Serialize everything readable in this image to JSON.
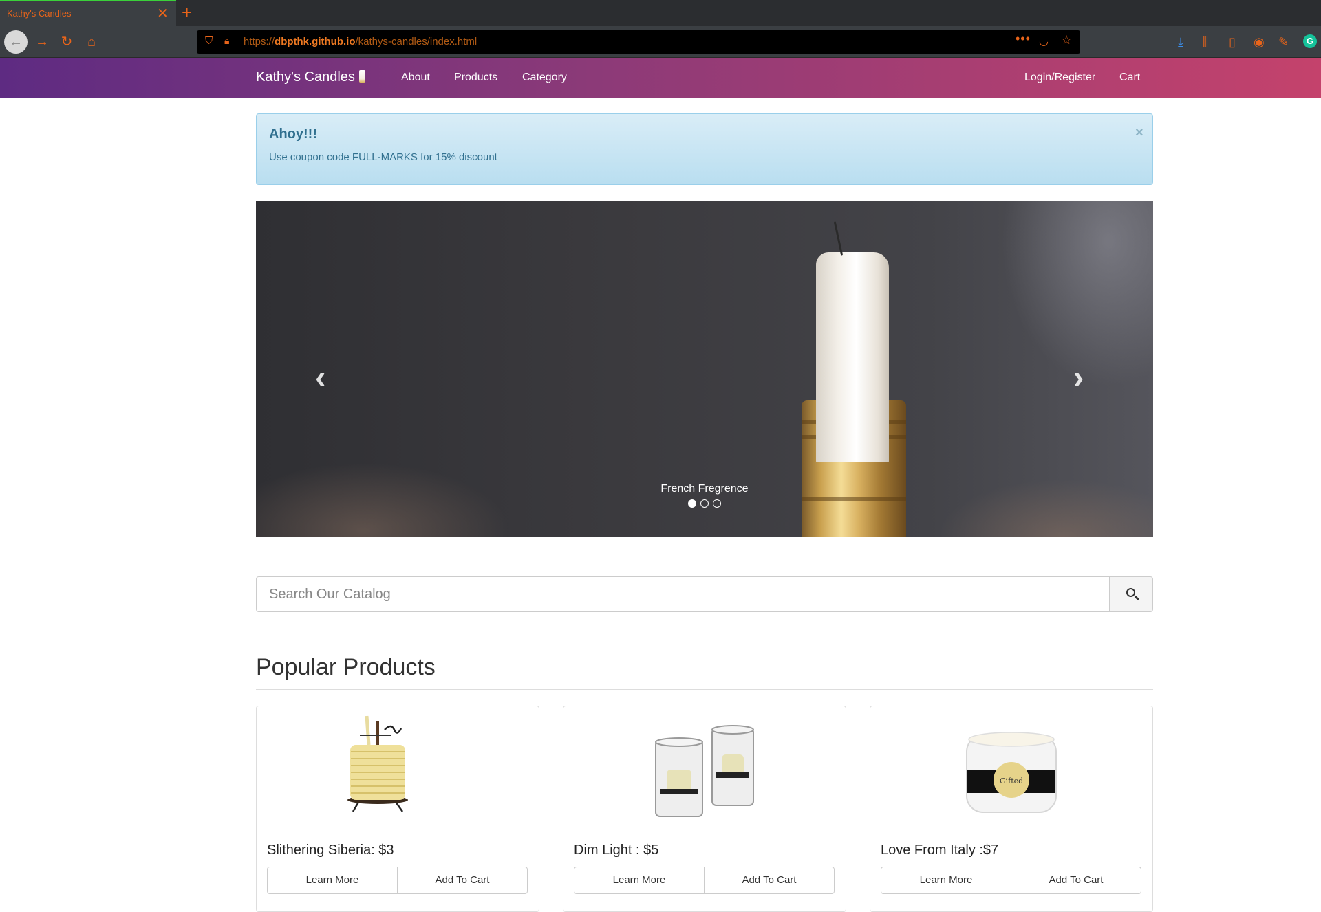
{
  "browser": {
    "tab_title": "Kathy's Candles",
    "tab_close": "✕",
    "new_tab": "+",
    "url_scheme": "https://",
    "url_host": "dbpthk.github.io",
    "url_path": "/kathys-candles/index.html",
    "url_more": "•••",
    "icons": [
      "back-icon",
      "forward-icon",
      "reload-icon",
      "home-icon",
      "shield-icon",
      "lock-icon",
      "pocket-icon",
      "star-icon",
      "download-icon",
      "library-icon",
      "sidebar-icon",
      "account-icon",
      "screenshot-icon",
      "grammarly-icon"
    ],
    "accent_color": "#e8641a"
  },
  "navbar": {
    "brand": "Kathy's Candles",
    "links": [
      "About",
      "Products",
      "Category"
    ],
    "right_links": [
      "Login/Register",
      "Cart"
    ],
    "gradient_start": "#5e2b82",
    "gradient_end": "#c4426c"
  },
  "alert": {
    "title": "Ahoy!!!",
    "message": "Use coupon code FULL-MARKS for 15% discount",
    "close": "×"
  },
  "carousel": {
    "caption": "French Fregrence",
    "prev_symbol": "‹",
    "next_symbol": "›",
    "slide_count": 3,
    "active_slide": 1
  },
  "search": {
    "placeholder": "Search Our Catalog"
  },
  "popular": {
    "title": "Popular Products",
    "products": [
      {
        "name": "Slithering Siberia: $3",
        "learn": "Learn More",
        "cart": "Add To Cart"
      },
      {
        "name": "Dim Light : $5",
        "learn": "Learn More",
        "cart": "Add To Cart"
      },
      {
        "name": "Love From Italy :$7",
        "learn": "Learn More",
        "cart": "Add To Cart",
        "label": "Gifted"
      }
    ]
  }
}
